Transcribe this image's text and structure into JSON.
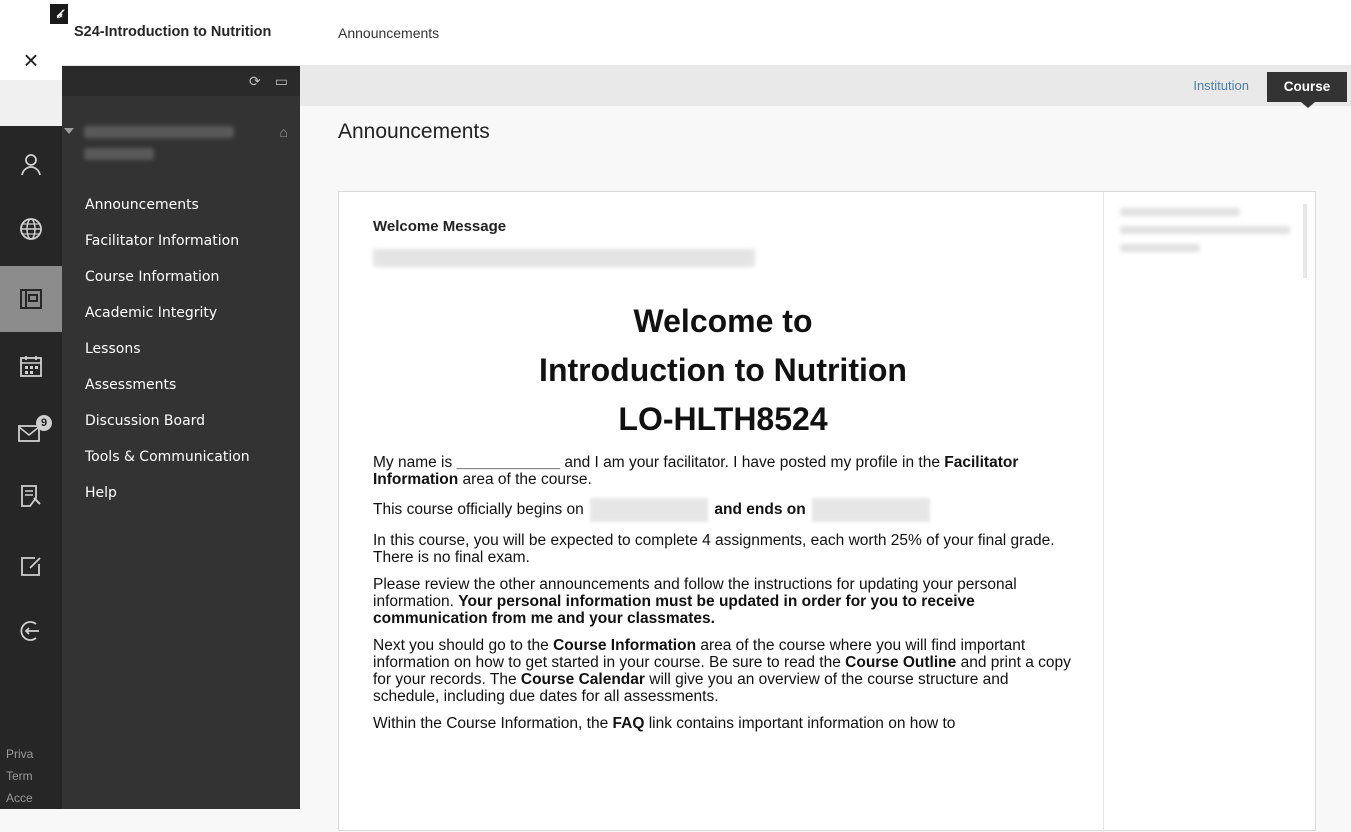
{
  "topbar": {
    "course_title": "S24-Introduction to Nutrition",
    "breadcrumb": "Announcements"
  },
  "basenav": {
    "close_label": "×",
    "icons": [
      "profile-icon",
      "globe-icon",
      "courses-icon",
      "calendar-icon",
      "messages-icon",
      "grades-icon",
      "tools-icon",
      "logout-icon"
    ],
    "messages_badge": "9",
    "footer": [
      "Priva",
      "Term",
      "Acce"
    ]
  },
  "course_menu": {
    "items": [
      {
        "label": "Announcements"
      },
      {
        "label": "Facilitator Information"
      },
      {
        "label": "Course Information"
      },
      {
        "label": "Academic Integrity"
      },
      {
        "label": "Lessons"
      },
      {
        "label": "Assessments"
      },
      {
        "label": "Discussion Board"
      },
      {
        "label": "Tools & Communication"
      },
      {
        "label": "Help"
      }
    ]
  },
  "context_bar": {
    "institution": "Institution",
    "course": "Course"
  },
  "page": {
    "title": "Announcements"
  },
  "announcement": {
    "title": "Welcome Message",
    "headline": [
      "Welcome to",
      "Introduction to Nutrition",
      "LO-HLTH8524"
    ],
    "p1_a": "My name is ",
    "p1_blank": "____________",
    "p1_b": " and I am your facilitator. I have posted my profile in the ",
    "p1_bold": "Facilitator Information",
    "p1_c": " area of the course.",
    "p2_a": "This course officially begins on ",
    "p2_bold": "and ends on",
    "p3": "In this course, you will be expected to complete 4 assignments, each worth 25% of your final grade. There is no final exam.",
    "p4_a": "Please review the other announcements and follow the instructions for updating your personal information. ",
    "p4_bold": "Your personal information must be updated in order for you to receive communication from me and your classmates.",
    "p5_a": "Next you should go to the ",
    "p5_b1": "Course Information",
    "p5_b": " area of the course where you will find important information on how to get started in your course. Be sure to read the ",
    "p5_b2": "Course Outline",
    "p5_c": " and print a copy for your records. The ",
    "p5_b3": "Course Calendar",
    "p5_d": " will give you an overview of the course structure and schedule, including due dates for all assessments.",
    "p6_a": "Within the Course Information, the ",
    "p6_bold": "FAQ",
    "p6_b": " link contains important information on how to"
  }
}
